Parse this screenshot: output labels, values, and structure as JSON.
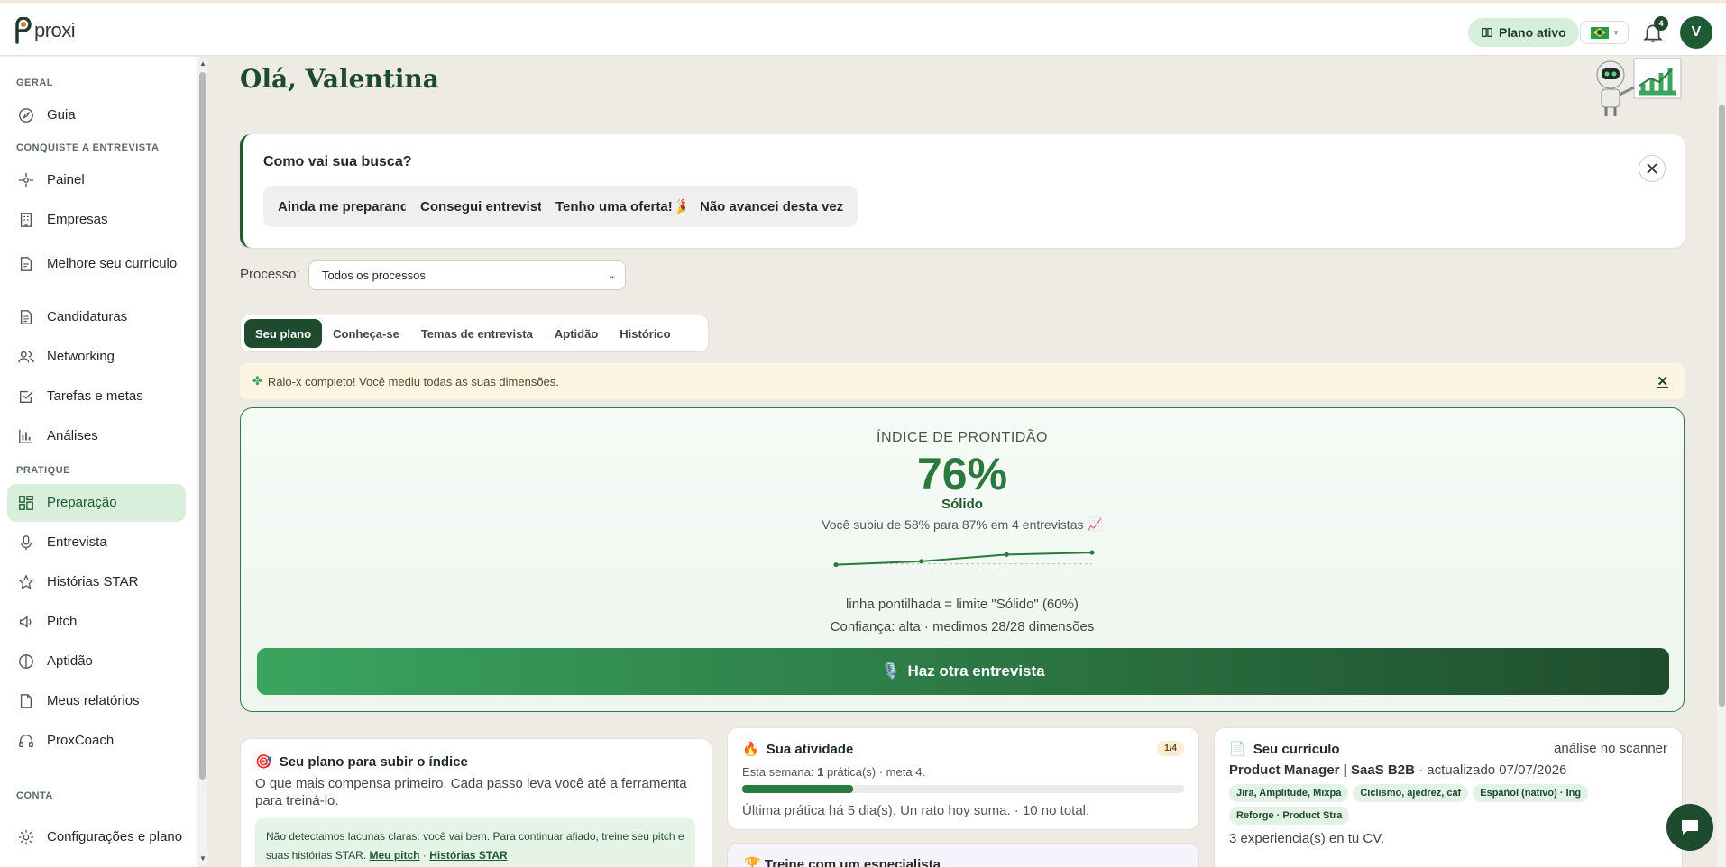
{
  "app": {
    "name": "proxi"
  },
  "topbar": {
    "plan_label": "Plano ativo",
    "notifications_count": "4",
    "avatar_initial": "V"
  },
  "sidebar": {
    "sections": [
      {
        "label": "GERAL"
      },
      {
        "label": "CONQUISTE A ENTREVISTA"
      },
      {
        "label": "PRATIQUE"
      },
      {
        "label": "CONTA"
      }
    ],
    "items": [
      {
        "label": "Guia",
        "icon": "compass-icon"
      },
      {
        "label": "Painel",
        "icon": "crosshair-icon"
      },
      {
        "label": "Empresas",
        "icon": "building-icon"
      },
      {
        "label": "Melhore seu currículo",
        "icon": "document-edit-icon"
      },
      {
        "label": "Candidaturas",
        "icon": "document-icon"
      },
      {
        "label": "Networking",
        "icon": "people-icon"
      },
      {
        "label": "Tarefas e metas",
        "icon": "checkbox-icon"
      },
      {
        "label": "Análises",
        "icon": "bar-chart-icon"
      },
      {
        "label": "Preparação",
        "icon": "grid-icon",
        "active": true
      },
      {
        "label": "Entrevista",
        "icon": "microphone-icon"
      },
      {
        "label": "Histórias STAR",
        "icon": "star-icon"
      },
      {
        "label": "Pitch",
        "icon": "speaker-icon"
      },
      {
        "label": "Aptidão",
        "icon": "half-circle-icon"
      },
      {
        "label": "Meus relatórios",
        "icon": "file-icon"
      },
      {
        "label": "ProxCoach",
        "icon": "headphones-icon"
      },
      {
        "label": "Configurações e plano",
        "icon": "gear-icon"
      }
    ]
  },
  "main": {
    "greeting": "Olá, Valentina",
    "survey": {
      "question": "Como vai sua busca?",
      "options": [
        "Ainda me preparando",
        "Consegui entrevista!",
        "Tenho uma oferta! 🎉",
        "Não avancei desta vez"
      ]
    },
    "process": {
      "label": "Processo:",
      "selected": "Todos os processos"
    },
    "tabs": [
      "Seu plano",
      "Conheça-se",
      "Temas de entrevista",
      "Aptidão",
      "Histórico"
    ],
    "alert": {
      "text": "Raio-x completo! Você mediu todas as suas dimensões.",
      "close": "✕"
    },
    "readiness": {
      "title": "ÍNDICE DE PRONTIDÃO",
      "value": "76%",
      "level": "Sólido",
      "trend": "Você subiu de 58% para 87% em 4 entrevistas 📈",
      "note": "linha pontilhada = limite \"Sólido\" (60%)",
      "confidence": "Confiança: alta · medimos 28/28 dimensões",
      "cta": "Haz otra entrevista",
      "sparkline": [
        58,
        66,
        82,
        87
      ],
      "threshold": 60
    },
    "plan_card": {
      "title": "Seu plano para subir o índice",
      "desc": "O que mais compensa primeiro. Cada passo leva você até a ferramenta para treiná-lo.",
      "box": "Não detectamos lacunas claras: você vai bem. Para continuar afiado, treine seu pitch e suas histórias STAR.",
      "link1": "Meu pitch",
      "sep": "·",
      "link2": "Histórias STAR"
    },
    "activity": {
      "title": "Sua atividade",
      "badge": "1/4",
      "week_prefix": "Esta semana: ",
      "week_count": "1",
      "week_suffix": " prática(s) · meta 4.",
      "progress": 0.25,
      "last": "Última prática há 5 dia(s). Un rato hoy suma. · 10 no total."
    },
    "coach": {
      "title": "Treine com um especialista"
    },
    "cv": {
      "title": "Seu currículo",
      "scanner": "análise no scanner",
      "role": "Product Manager | SaaS B2B",
      "updated": " · actualizado 07/07/2026",
      "chips": [
        "Jira, Amplitude, Mixpa",
        "Ciclismo, ajedrez, caf",
        "Español (nativo) · Ing",
        "Reforge · Product Stra"
      ],
      "experience": "3 experiencia(s) en tu CV."
    }
  },
  "colors": {
    "brand": "#1e4a2e",
    "accent": "#2a7a3e",
    "plan_pill": "#d6eedc"
  }
}
